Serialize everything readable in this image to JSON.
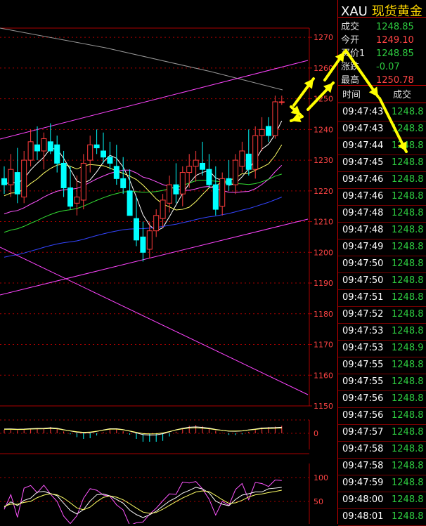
{
  "chart_data": [
    {
      "type": "candlestick",
      "y_axis_ticks": [
        "1270",
        "1260",
        "1250",
        "1240",
        "1230",
        "1220",
        "1210",
        "1200",
        "1190",
        "1180",
        "1170",
        "1160",
        "1150"
      ],
      "ylim": [
        1150,
        1273
      ],
      "grid": true,
      "candles": [
        {
          "o": 1224,
          "h": 1228,
          "l": 1219,
          "c": 1222
        },
        {
          "o": 1222,
          "h": 1232,
          "l": 1218,
          "c": 1227
        },
        {
          "o": 1226,
          "h": 1234,
          "l": 1216,
          "c": 1219
        },
        {
          "o": 1218,
          "h": 1233,
          "l": 1216,
          "c": 1230
        },
        {
          "o": 1230,
          "h": 1240,
          "l": 1228,
          "c": 1236
        },
        {
          "o": 1235,
          "h": 1241,
          "l": 1230,
          "c": 1233
        },
        {
          "o": 1233,
          "h": 1239,
          "l": 1227,
          "c": 1237
        },
        {
          "o": 1236,
          "h": 1242,
          "l": 1232,
          "c": 1233
        },
        {
          "o": 1235,
          "h": 1238,
          "l": 1226,
          "c": 1229
        },
        {
          "o": 1229,
          "h": 1233,
          "l": 1218,
          "c": 1221
        },
        {
          "o": 1221,
          "h": 1228,
          "l": 1214,
          "c": 1215
        },
        {
          "o": 1216,
          "h": 1225,
          "l": 1212,
          "c": 1218
        },
        {
          "o": 1217,
          "h": 1232,
          "l": 1214,
          "c": 1229
        },
        {
          "o": 1230,
          "h": 1238,
          "l": 1226,
          "c": 1235
        },
        {
          "o": 1235,
          "h": 1240,
          "l": 1232,
          "c": 1234
        },
        {
          "o": 1233,
          "h": 1239,
          "l": 1229,
          "c": 1231
        },
        {
          "o": 1231,
          "h": 1236,
          "l": 1227,
          "c": 1229
        },
        {
          "o": 1228,
          "h": 1235,
          "l": 1222,
          "c": 1224
        },
        {
          "o": 1224,
          "h": 1231,
          "l": 1219,
          "c": 1221
        },
        {
          "o": 1220,
          "h": 1227,
          "l": 1216,
          "c": 1212
        },
        {
          "o": 1211,
          "h": 1218,
          "l": 1202,
          "c": 1204
        },
        {
          "o": 1205,
          "h": 1210,
          "l": 1197,
          "c": 1200
        },
        {
          "o": 1201,
          "h": 1210,
          "l": 1198,
          "c": 1207
        },
        {
          "o": 1207,
          "h": 1214,
          "l": 1205,
          "c": 1212
        },
        {
          "o": 1211,
          "h": 1219,
          "l": 1208,
          "c": 1217
        },
        {
          "o": 1216,
          "h": 1225,
          "l": 1213,
          "c": 1222
        },
        {
          "o": 1222,
          "h": 1229,
          "l": 1216,
          "c": 1219
        },
        {
          "o": 1219,
          "h": 1228,
          "l": 1215,
          "c": 1226
        },
        {
          "o": 1226,
          "h": 1232,
          "l": 1221,
          "c": 1228
        },
        {
          "o": 1228,
          "h": 1233,
          "l": 1223,
          "c": 1230
        },
        {
          "o": 1229,
          "h": 1236,
          "l": 1225,
          "c": 1227
        },
        {
          "o": 1227,
          "h": 1232,
          "l": 1221,
          "c": 1222
        },
        {
          "o": 1222,
          "h": 1228,
          "l": 1212,
          "c": 1214
        },
        {
          "o": 1215,
          "h": 1226,
          "l": 1212,
          "c": 1224
        },
        {
          "o": 1224,
          "h": 1230,
          "l": 1220,
          "c": 1222
        },
        {
          "o": 1222,
          "h": 1232,
          "l": 1219,
          "c": 1230
        },
        {
          "o": 1228,
          "h": 1236,
          "l": 1226,
          "c": 1233
        },
        {
          "o": 1232,
          "h": 1240,
          "l": 1225,
          "c": 1227
        },
        {
          "o": 1227,
          "h": 1241,
          "l": 1224,
          "c": 1238
        },
        {
          "o": 1238,
          "h": 1244,
          "l": 1233,
          "c": 1240
        },
        {
          "o": 1241,
          "h": 1244,
          "l": 1236,
          "c": 1238
        },
        {
          "o": 1238,
          "h": 1251,
          "l": 1237,
          "c": 1249
        },
        {
          "o": 1249,
          "h": 1251,
          "l": 1248,
          "c": 1249
        }
      ]
    },
    {
      "type": "line",
      "y_axis_ticks": [
        "0"
      ]
    },
    {
      "type": "line",
      "y_axis_ticks": [
        "100",
        "50"
      ]
    }
  ],
  "symbol": "XAU",
  "name": "现货黄金",
  "quote": [
    {
      "label": "成交",
      "value": "1248.85",
      "color": "#2ecc40"
    },
    {
      "label": "今开",
      "value": "1249.10",
      "color": "#ff4444"
    },
    {
      "label": "买价1",
      "value": "1248.85",
      "color": "#2ecc40"
    },
    {
      "label": "涨跌",
      "value": "-0.07",
      "color": "#2ecc40"
    },
    {
      "label": "最高",
      "value": "1250.78",
      "color": "#ff4444"
    }
  ],
  "ticks_header": {
    "time": "时间",
    "price": "成交"
  },
  "ticks": [
    {
      "time": "09:47:43",
      "price": "1248.8"
    },
    {
      "time": "09:47:43",
      "price": "1248.8"
    },
    {
      "time": "09:47:44",
      "price": "1248.8"
    },
    {
      "time": "09:47:45",
      "price": "1248.8"
    },
    {
      "time": "09:47:46",
      "price": "1248.8"
    },
    {
      "time": "09:47:46",
      "price": "1248.8"
    },
    {
      "time": "09:47:48",
      "price": "1248.8"
    },
    {
      "time": "09:47:48",
      "price": "1248.8"
    },
    {
      "time": "09:47:49",
      "price": "1248.8"
    },
    {
      "time": "09:47:50",
      "price": "1248.8"
    },
    {
      "time": "09:47:50",
      "price": "1248.8"
    },
    {
      "time": "09:47:51",
      "price": "1248.8"
    },
    {
      "time": "09:47:52",
      "price": "1248.8"
    },
    {
      "time": "09:47:53",
      "price": "1248.8"
    },
    {
      "time": "09:47:53",
      "price": "1248.9"
    },
    {
      "time": "09:47:55",
      "price": "1248.8"
    },
    {
      "time": "09:47:55",
      "price": "1248.8"
    },
    {
      "time": "09:47:56",
      "price": "1248.8"
    },
    {
      "time": "09:47:56",
      "price": "1248.8"
    },
    {
      "time": "09:47:57",
      "price": "1248.8"
    },
    {
      "time": "09:47:58",
      "price": "1248.8"
    },
    {
      "time": "09:47:58",
      "price": "1248.8"
    },
    {
      "time": "09:47:59",
      "price": "1248.8"
    },
    {
      "time": "09:48:00",
      "price": "1248.8"
    },
    {
      "time": "09:48:01",
      "price": "1248.8"
    }
  ],
  "colors": {
    "up": "#ff3b3b",
    "down": "#00ffff",
    "ma5": "#ffffff",
    "ma10": "#ffff66",
    "ma20": "#ff55ff",
    "ma30": "#33dd33",
    "ma60": "#3344ff",
    "ma_slow": "#999999",
    "trendline": "#ff44ff",
    "arrow": "#ffff00",
    "grid": "#aa0000"
  }
}
